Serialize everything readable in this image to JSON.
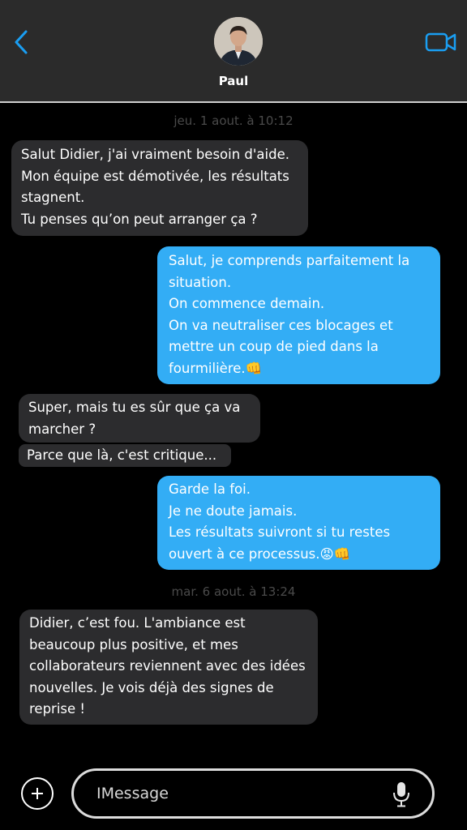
{
  "header": {
    "contact_name": "Paul",
    "back_icon": "chevron-left-icon",
    "video_icon": "video-camera-icon",
    "accent_color": "#1a9ef2"
  },
  "conversation": {
    "timestamps": [
      "jeu. 1 aout. à 10:12",
      "mar. 6 aout. à 13:24"
    ],
    "messages": [
      {
        "direction": "incoming",
        "text": "Salut Didier, j'ai vraiment besoin d'aide.\nMon équipe est démotivée, les résultats stagnent.\nTu penses qu’on peut arranger ça ?"
      },
      {
        "direction": "outgoing",
        "text": "Salut, je comprends parfaitement la situation.\nOn commence demain.\nOn va neutraliser ces blocages et mettre un coup de pied dans la fourmilière.👊"
      },
      {
        "direction": "incoming",
        "text": "Super, mais tu es sûr que ça va marcher ?"
      },
      {
        "direction": "incoming",
        "text": "Parce que là, c'est critique..."
      },
      {
        "direction": "outgoing",
        "text": "Garde la foi.\nJe ne doute jamais.\nLes résultats suivront si tu restes ouvert à ce processus.😡👊"
      },
      {
        "direction": "incoming",
        "text": "Didier, c’est fou. L'ambiance est beaucoup plus positive, et mes collaborateurs reviennent avec des idées nouvelles. Je vois déjà des signes de reprise !"
      }
    ],
    "incoming_color": "#2c2c2e",
    "outgoing_color": "#33adf5"
  },
  "composer": {
    "placeholder": "IMessage",
    "value": "",
    "plus_icon": "plus-circle-icon",
    "mic_icon": "microphone-icon"
  }
}
